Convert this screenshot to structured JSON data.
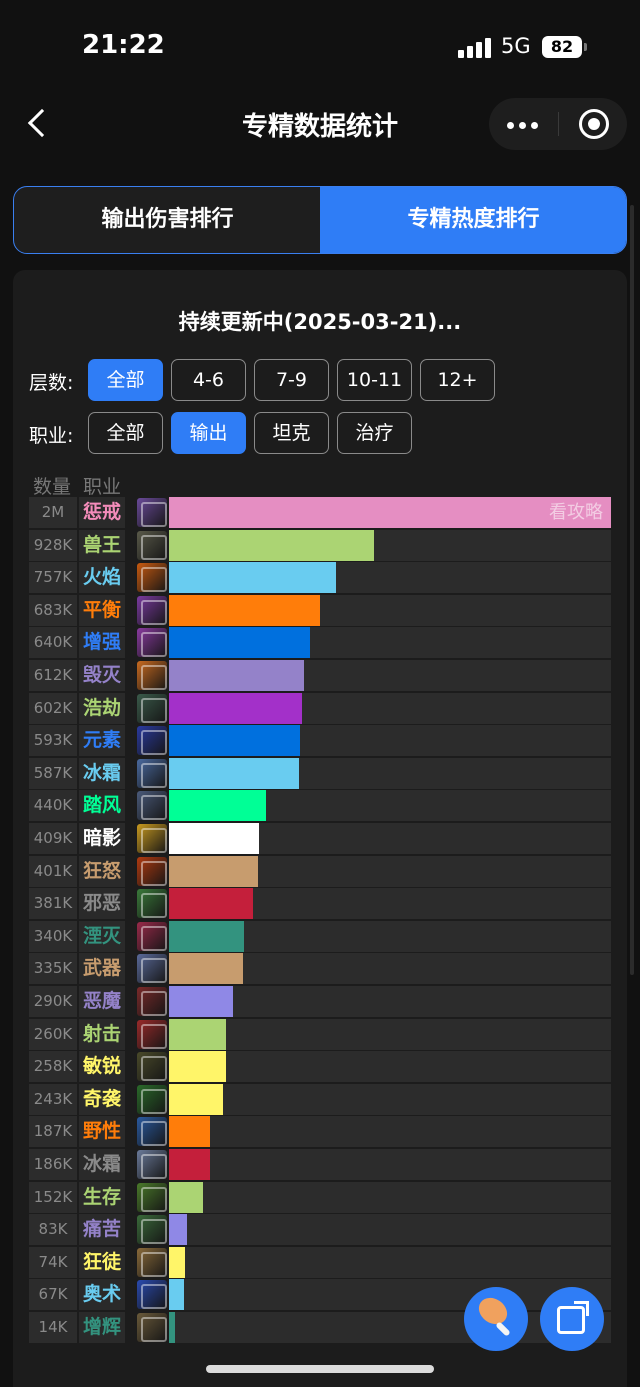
{
  "status_bar": {
    "time": "21:22",
    "network": "5G",
    "battery": "82"
  },
  "nav": {
    "title": "专精数据统计"
  },
  "tabs": {
    "damage": "输出伤害排行",
    "popularity": "专精热度排行",
    "active": "popularity"
  },
  "card": {
    "update_text": "持续更新中(2025-03-21)...",
    "level_filter": {
      "label": "层数:",
      "options": [
        "全部",
        "4-6",
        "7-9",
        "10-11",
        "12+"
      ],
      "selected": "全部"
    },
    "role_filter": {
      "label": "职业:",
      "options": [
        "全部",
        "输出",
        "坦克",
        "治疗"
      ],
      "selected": "输出"
    },
    "columns": {
      "count": "数量",
      "role": "职业"
    },
    "guide_link": "看攻略",
    "rows": [
      {
        "count": "2M",
        "name": "惩戒",
        "value": 2000000,
        "color": "#e58ec2",
        "name_color": "#f48cba",
        "icon_color": "#6a4a9a"
      },
      {
        "count": "928K",
        "name": "兽王",
        "value": 928000,
        "color": "#abd473",
        "name_color": "#abd473",
        "icon_color": "#5a5a4a"
      },
      {
        "count": "757K",
        "name": "火焰",
        "value": 757000,
        "color": "#69ccf0",
        "name_color": "#69ccf0",
        "icon_color": "#c85a10"
      },
      {
        "count": "683K",
        "name": "平衡",
        "value": 683000,
        "color": "#ff7d0a",
        "name_color": "#ff7d0a",
        "icon_color": "#7a3aa0"
      },
      {
        "count": "640K",
        "name": "增强",
        "value": 640000,
        "color": "#0070de",
        "name_color": "#2f7df6",
        "icon_color": "#8a3aa0"
      },
      {
        "count": "612K",
        "name": "毁灭",
        "value": 612000,
        "color": "#9482c9",
        "name_color": "#9482c9",
        "icon_color": "#c86a20"
      },
      {
        "count": "602K",
        "name": "浩劫",
        "value": 602000,
        "color": "#a330c9",
        "name_color": "#abd473",
        "icon_color": "#3a5a4a"
      },
      {
        "count": "593K",
        "name": "元素",
        "value": 593000,
        "color": "#0070de",
        "name_color": "#2f7df6",
        "icon_color": "#2a3aa0"
      },
      {
        "count": "587K",
        "name": "冰霜",
        "value": 587000,
        "color": "#69ccf0",
        "name_color": "#69ccf0",
        "icon_color": "#4a6aa0"
      },
      {
        "count": "440K",
        "name": "踏风",
        "value": 440000,
        "color": "#00ff96",
        "name_color": "#00ff96",
        "icon_color": "#4a5a7a"
      },
      {
        "count": "409K",
        "name": "暗影",
        "value": 409000,
        "color": "#ffffff",
        "name_color": "#ffffff",
        "icon_color": "#c89a20"
      },
      {
        "count": "401K",
        "name": "狂怒",
        "value": 401000,
        "color": "#c79c6e",
        "name_color": "#c79c6e",
        "icon_color": "#b03a10"
      },
      {
        "count": "381K",
        "name": "邪恶",
        "value": 381000,
        "color": "#c41f3b",
        "name_color": "#8a8a8a",
        "icon_color": "#3a7a3a"
      },
      {
        "count": "340K",
        "name": "湮灭",
        "value": 340000,
        "color": "#33937f",
        "name_color": "#33937f",
        "icon_color": "#9a2a4a"
      },
      {
        "count": "335K",
        "name": "武器",
        "value": 335000,
        "color": "#c79c6e",
        "name_color": "#c79c6e",
        "icon_color": "#5a6a9a"
      },
      {
        "count": "290K",
        "name": "恶魔",
        "value": 290000,
        "color": "#8f88e6",
        "name_color": "#9482c9",
        "icon_color": "#7a2a2a"
      },
      {
        "count": "260K",
        "name": "射击",
        "value": 260000,
        "color": "#abd473",
        "name_color": "#abd473",
        "icon_color": "#9a2a2a"
      },
      {
        "count": "258K",
        "name": "敏锐",
        "value": 258000,
        "color": "#fff569",
        "name_color": "#fff569",
        "icon_color": "#4a4a2a"
      },
      {
        "count": "243K",
        "name": "奇袭",
        "value": 243000,
        "color": "#fff569",
        "name_color": "#fff569",
        "icon_color": "#2a6a2a"
      },
      {
        "count": "187K",
        "name": "野性",
        "value": 187000,
        "color": "#ff7d0a",
        "name_color": "#ff7d0a",
        "icon_color": "#2a5aa0"
      },
      {
        "count": "186K",
        "name": "冰霜",
        "value": 186000,
        "color": "#c41f3b",
        "name_color": "#8a8a8a",
        "icon_color": "#6a7a9a"
      },
      {
        "count": "152K",
        "name": "生存",
        "value": 152000,
        "color": "#abd473",
        "name_color": "#abd473",
        "icon_color": "#4a7a2a"
      },
      {
        "count": "83K",
        "name": "痛苦",
        "value": 83000,
        "color": "#8f88e6",
        "name_color": "#9482c9",
        "icon_color": "#3a6a3a"
      },
      {
        "count": "74K",
        "name": "狂徒",
        "value": 74000,
        "color": "#fff569",
        "name_color": "#fff569",
        "icon_color": "#8a6a3a"
      },
      {
        "count": "67K",
        "name": "奥术",
        "value": 67000,
        "color": "#69ccf0",
        "name_color": "#69ccf0",
        "icon_color": "#2a4ab0"
      },
      {
        "count": "14K",
        "name": "增辉",
        "value": 14000,
        "color": "#33937f",
        "name_color": "#33937f",
        "icon_color": "#6a5a3a"
      }
    ]
  }
}
